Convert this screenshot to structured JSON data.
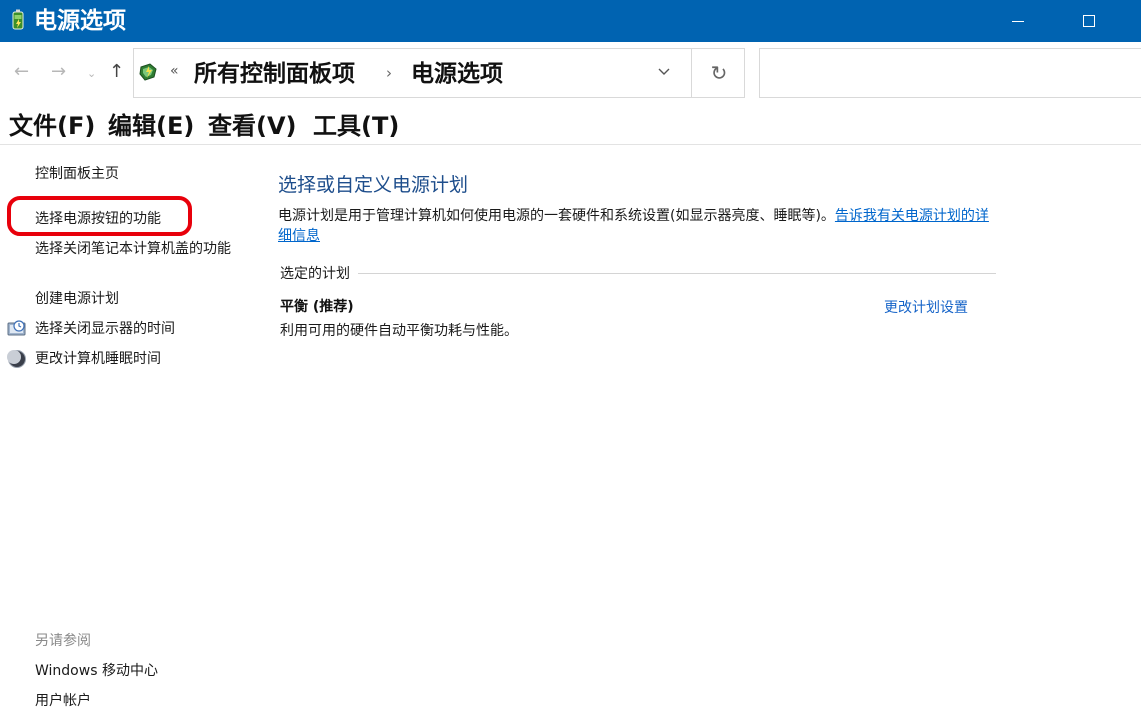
{
  "window": {
    "title": "电源选项",
    "titlebar_color": "#0063b1"
  },
  "address_bar": {
    "overflow_chevron": "«",
    "breadcrumbs": [
      "所有控制面板项",
      "电源选项"
    ],
    "separator": "›",
    "refresh_glyph": "↻"
  },
  "nav": {
    "back": "←",
    "forward": "→",
    "recent": "⌄",
    "up": "↑"
  },
  "menu": {
    "items": [
      "文件(F)",
      "编辑(E)",
      "查看(V)",
      "工具(T)"
    ]
  },
  "left_pane": {
    "links": [
      {
        "label": "控制面板主页"
      },
      {
        "label": "选择电源按钮的功能",
        "highlighted": true
      },
      {
        "label": "选择关闭笔记本计算机盖的功能"
      },
      {
        "label": "创建电源计划"
      },
      {
        "label": "选择关闭显示器的时间",
        "icon": "monitor-icon"
      },
      {
        "label": "更改计算机睡眠时间",
        "icon": "moon-icon"
      }
    ],
    "see_also_label": "另请参阅",
    "see_also_links": [
      "Windows 移动中心",
      "用户帐户"
    ],
    "highlight_color": "#e8000b"
  },
  "main": {
    "heading": "选择或自定义电源计划",
    "description": "电源计划是用于管理计算机如何使用电源的一套硬件和系统设置(如显示器亮度、睡眠等)。",
    "description_link": "告诉我有关电源计划的详细信息",
    "section_label": "选定的计划",
    "plan": {
      "name": "平衡 (推荐)",
      "description": "利用可用的硬件自动平衡功耗与性能。",
      "change_settings_label": "更改计划设置"
    },
    "link_color": "#1664c8"
  }
}
